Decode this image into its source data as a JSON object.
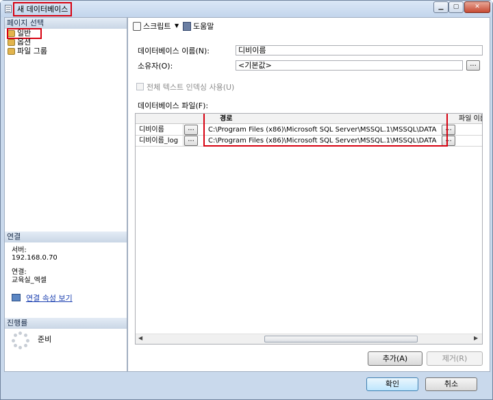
{
  "window": {
    "title": "새 데이터베이스"
  },
  "left": {
    "pages_header": "페이지 선택",
    "pages": [
      "일반",
      "옵션",
      "파일 그룹"
    ],
    "connection_header": "연결",
    "server_label": "서버:",
    "server_value": "192.168.0.70",
    "connection_label": "연결:",
    "connection_value": "교육실_엑셀",
    "connection_link": "연결 속성 보기",
    "progress_header": "진행률",
    "progress_status": "준비"
  },
  "toolbar": {
    "script_label": "스크립트",
    "help_label": "도움말"
  },
  "form": {
    "dbname_label": "데이터베이스 이름(N):",
    "dbname_value": "디비이름",
    "owner_label": "소유자(O):",
    "owner_value": "<기본값>",
    "fulltext_label": "전체 텍스트 인덱싱 사용(U)",
    "files_label": "데이터베이스 파일(F):"
  },
  "grid": {
    "headers": {
      "path": "경로",
      "filename": "파일 이름"
    },
    "rows": [
      {
        "name": "디비이름",
        "path": "C:\\Program Files (x86)\\Microsoft SQL Server\\MSSQL.1\\MSSQL\\DATA"
      },
      {
        "name": "디비이름_log",
        "path": "C:\\Program Files (x86)\\Microsoft SQL Server\\MSSQL.1\\MSSQL\\DATA"
      }
    ],
    "ellipsis": "..."
  },
  "buttons": {
    "add": "추가(A)",
    "remove": "제거(R)",
    "ok": "확인",
    "cancel": "취소"
  }
}
